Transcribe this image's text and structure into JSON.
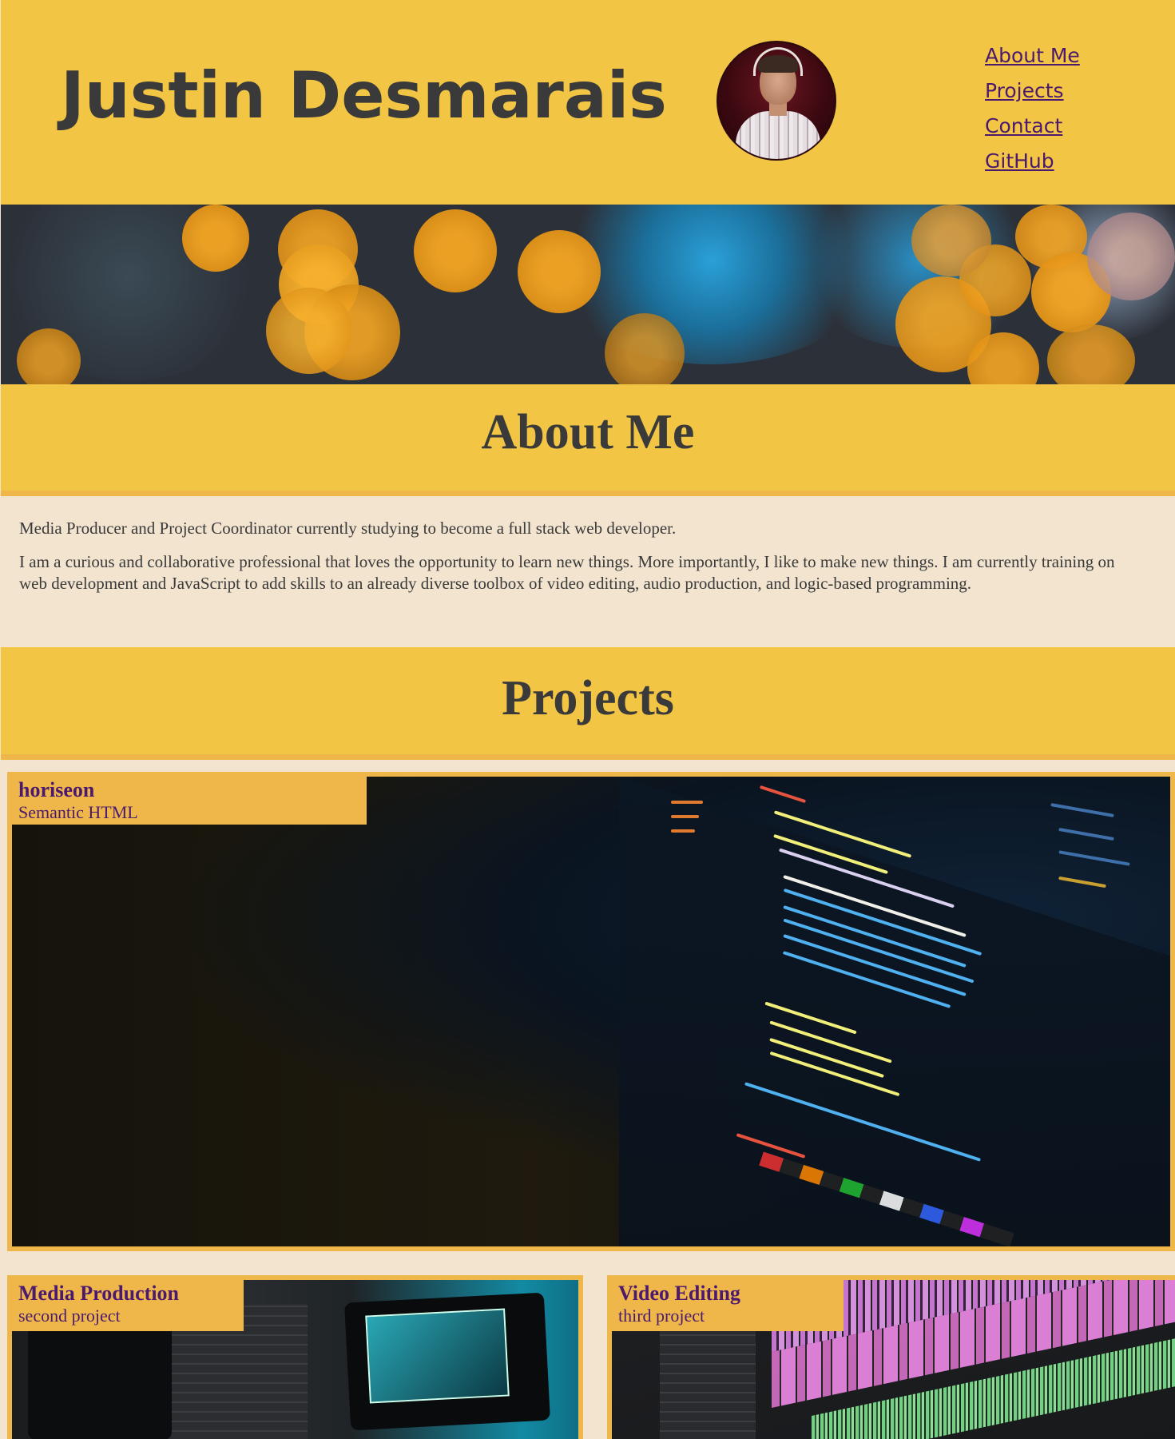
{
  "header": {
    "title": "Justin Desmarais",
    "nav": [
      {
        "label": "About Me"
      },
      {
        "label": "Projects"
      },
      {
        "label": "Contact"
      },
      {
        "label": "GitHub"
      }
    ]
  },
  "about": {
    "heading": "About Me",
    "paragraphs": [
      "Media Producer and Project Coordinator currently studying to become a full stack web developer.",
      "I am a curious and collaborative professional that loves the opportunity to learn new things. More importantly, I like to make new things. I am currently training on web development and JavaScript to add skills to an already diverse toolbox of video editing, audio production, and logic-based programming."
    ]
  },
  "projects": {
    "heading": "Projects",
    "items": [
      {
        "name": "horiseon",
        "subtitle": "Semantic HTML"
      },
      {
        "name": "Media Production",
        "subtitle": "second project"
      },
      {
        "name": "Video Editing",
        "subtitle": "third project"
      }
    ]
  },
  "colors": {
    "header_bg": "#f2c544",
    "card_bg": "#efb74a",
    "link": "#4b1a6e",
    "page_bg": "#f2e4cf",
    "text": "#3a3a3a"
  }
}
